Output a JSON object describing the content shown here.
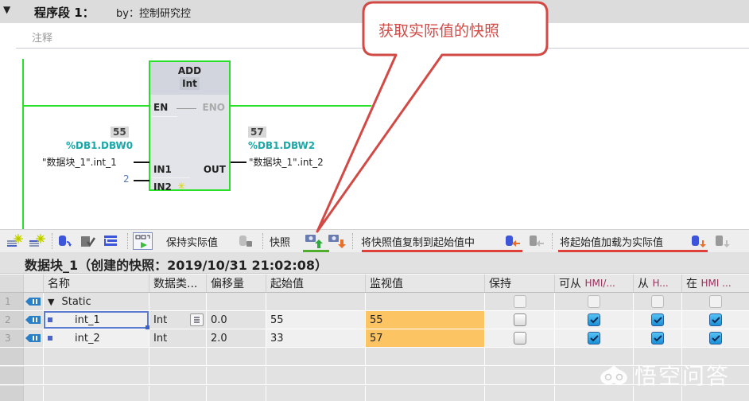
{
  "network": {
    "caret": "▼",
    "title": "程序段 1：",
    "author": "by：控制研究控",
    "comment_placeholder": "注释"
  },
  "ladder": {
    "block_name": "ADD",
    "block_type": "Int",
    "pins": {
      "en": "EN",
      "eno": "ENO",
      "in1": "IN1",
      "in2": "IN2",
      "out": "OUT"
    },
    "in1": {
      "monitor_value": "55",
      "address": "%DB1.DBW0",
      "operand": "\"数据块_1\".int_1"
    },
    "in2": {
      "constant": "2"
    },
    "out": {
      "monitor_value": "57",
      "address": "%DB1.DBW2",
      "operand": "\"数据块_1\".int_2"
    },
    "rail_color": "#28e028"
  },
  "callout": {
    "text": "获取实际值的快照",
    "color": "#d24a45"
  },
  "toolbar": {
    "icons": [
      "insert-row-icon",
      "add-row-icon",
      "db-extend-icon",
      "db-check-icon",
      "columns-icon",
      "monitor-toggle-icon"
    ],
    "keep_actual_label": "保持实际值",
    "snapshot_label": "快照",
    "copy_snapshot_label": "将快照值复制到起始值中",
    "load_start_label": "将起始值加载为实际值"
  },
  "db_title": "数据块_1（创建的快照：2019/10/31 21:02:08）",
  "table": {
    "headers": [
      "名称",
      "数据类...",
      "偏移量",
      "起始值",
      "监视值",
      "保持",
      "可从 HMI/...",
      "从 H...",
      "在 HMI ..."
    ],
    "header_hmi_parts": [
      {
        "pre": "可从 ",
        "hmi": "HMI/..."
      },
      {
        "pre": "从 ",
        "hmi": "H..."
      },
      {
        "pre": "在 ",
        "hmi": "HMI ..."
      }
    ],
    "rows": [
      {
        "num": "1",
        "name": "Static",
        "type": "",
        "offset": "",
        "start": "",
        "monitor": "",
        "retain": false,
        "hmi_access": false,
        "hmi_write": false,
        "hmi_visible": false,
        "is_section": true
      },
      {
        "num": "2",
        "name": "int_1",
        "type": "Int",
        "offset": "0.0",
        "start": "55",
        "monitor": "55",
        "retain": false,
        "hmi_access": true,
        "hmi_write": true,
        "hmi_visible": true,
        "is_section": false
      },
      {
        "num": "3",
        "name": "int_2",
        "type": "Int",
        "offset": "2.0",
        "start": "33",
        "monitor": "57",
        "retain": false,
        "hmi_access": true,
        "hmi_write": true,
        "hmi_visible": true,
        "is_section": false
      }
    ],
    "monitor_highlight": "#fcc462"
  },
  "watermark": "悟空问答"
}
